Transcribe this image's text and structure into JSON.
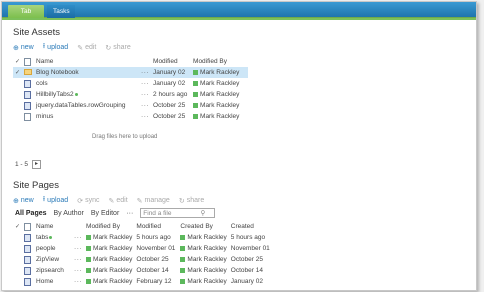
{
  "tabs": [
    {
      "label": "Tab Title"
    },
    {
      "label": "Tasks"
    }
  ],
  "assets": {
    "title": "Site Assets",
    "commands": {
      "new": "new",
      "upload": "upload",
      "edit": "edit",
      "share": "share"
    },
    "columns": {
      "name": "Name",
      "modified": "Modified",
      "modified_by": "Modified By"
    },
    "rows": [
      {
        "name": "Blog Notebook",
        "modified": "January 02",
        "modified_by": "Mark Rackley"
      },
      {
        "name": "cols",
        "modified": "January 02",
        "modified_by": "Mark Rackley"
      },
      {
        "name": "HillbillyTabs2",
        "modified": "2 hours ago",
        "modified_by": "Mark Rackley"
      },
      {
        "name": "jquery.dataTables.rowGrouping",
        "modified": "October 25",
        "modified_by": "Mark Rackley"
      },
      {
        "name": "minus",
        "modified": "October 25",
        "modified_by": "Mark Rackley"
      }
    ],
    "drop_text": "Drag files here to upload",
    "pager": "1 - 5"
  },
  "pages": {
    "title": "Site Pages",
    "commands": {
      "new": "new",
      "upload": "upload",
      "sync": "sync",
      "edit": "edit",
      "manage": "manage",
      "share": "share"
    },
    "views": {
      "all": "All Pages",
      "author": "By Author",
      "editor": "By Editor",
      "more": "···"
    },
    "find_placeholder": "Find a file",
    "columns": {
      "name": "Name",
      "modified_by": "Modified By",
      "modified": "Modified",
      "created_by": "Created By",
      "created": "Created"
    },
    "rows": [
      {
        "name": "tabs",
        "modified_by": "Mark Rackley",
        "modified": "5 hours ago",
        "created_by": "Mark Rackley",
        "created": "5 hours ago"
      },
      {
        "name": "people",
        "modified_by": "Mark Rackley",
        "modified": "November 01",
        "created_by": "Mark Rackley",
        "created": "November 01"
      },
      {
        "name": "ZipView",
        "modified_by": "Mark Rackley",
        "modified": "October 25",
        "created_by": "Mark Rackley",
        "created": "October 25"
      },
      {
        "name": "zipsearch",
        "modified_by": "Mark Rackley",
        "modified": "October 14",
        "created_by": "Mark Rackley",
        "created": "October 14"
      },
      {
        "name": "Home",
        "modified_by": "Mark Rackley",
        "modified": "February 12",
        "created_by": "Mark Rackley",
        "created": "January 02"
      }
    ]
  },
  "colors": {
    "accent": "#2a7ab8",
    "presence": "#5cb85c",
    "selected_row": "#cde6f7"
  }
}
